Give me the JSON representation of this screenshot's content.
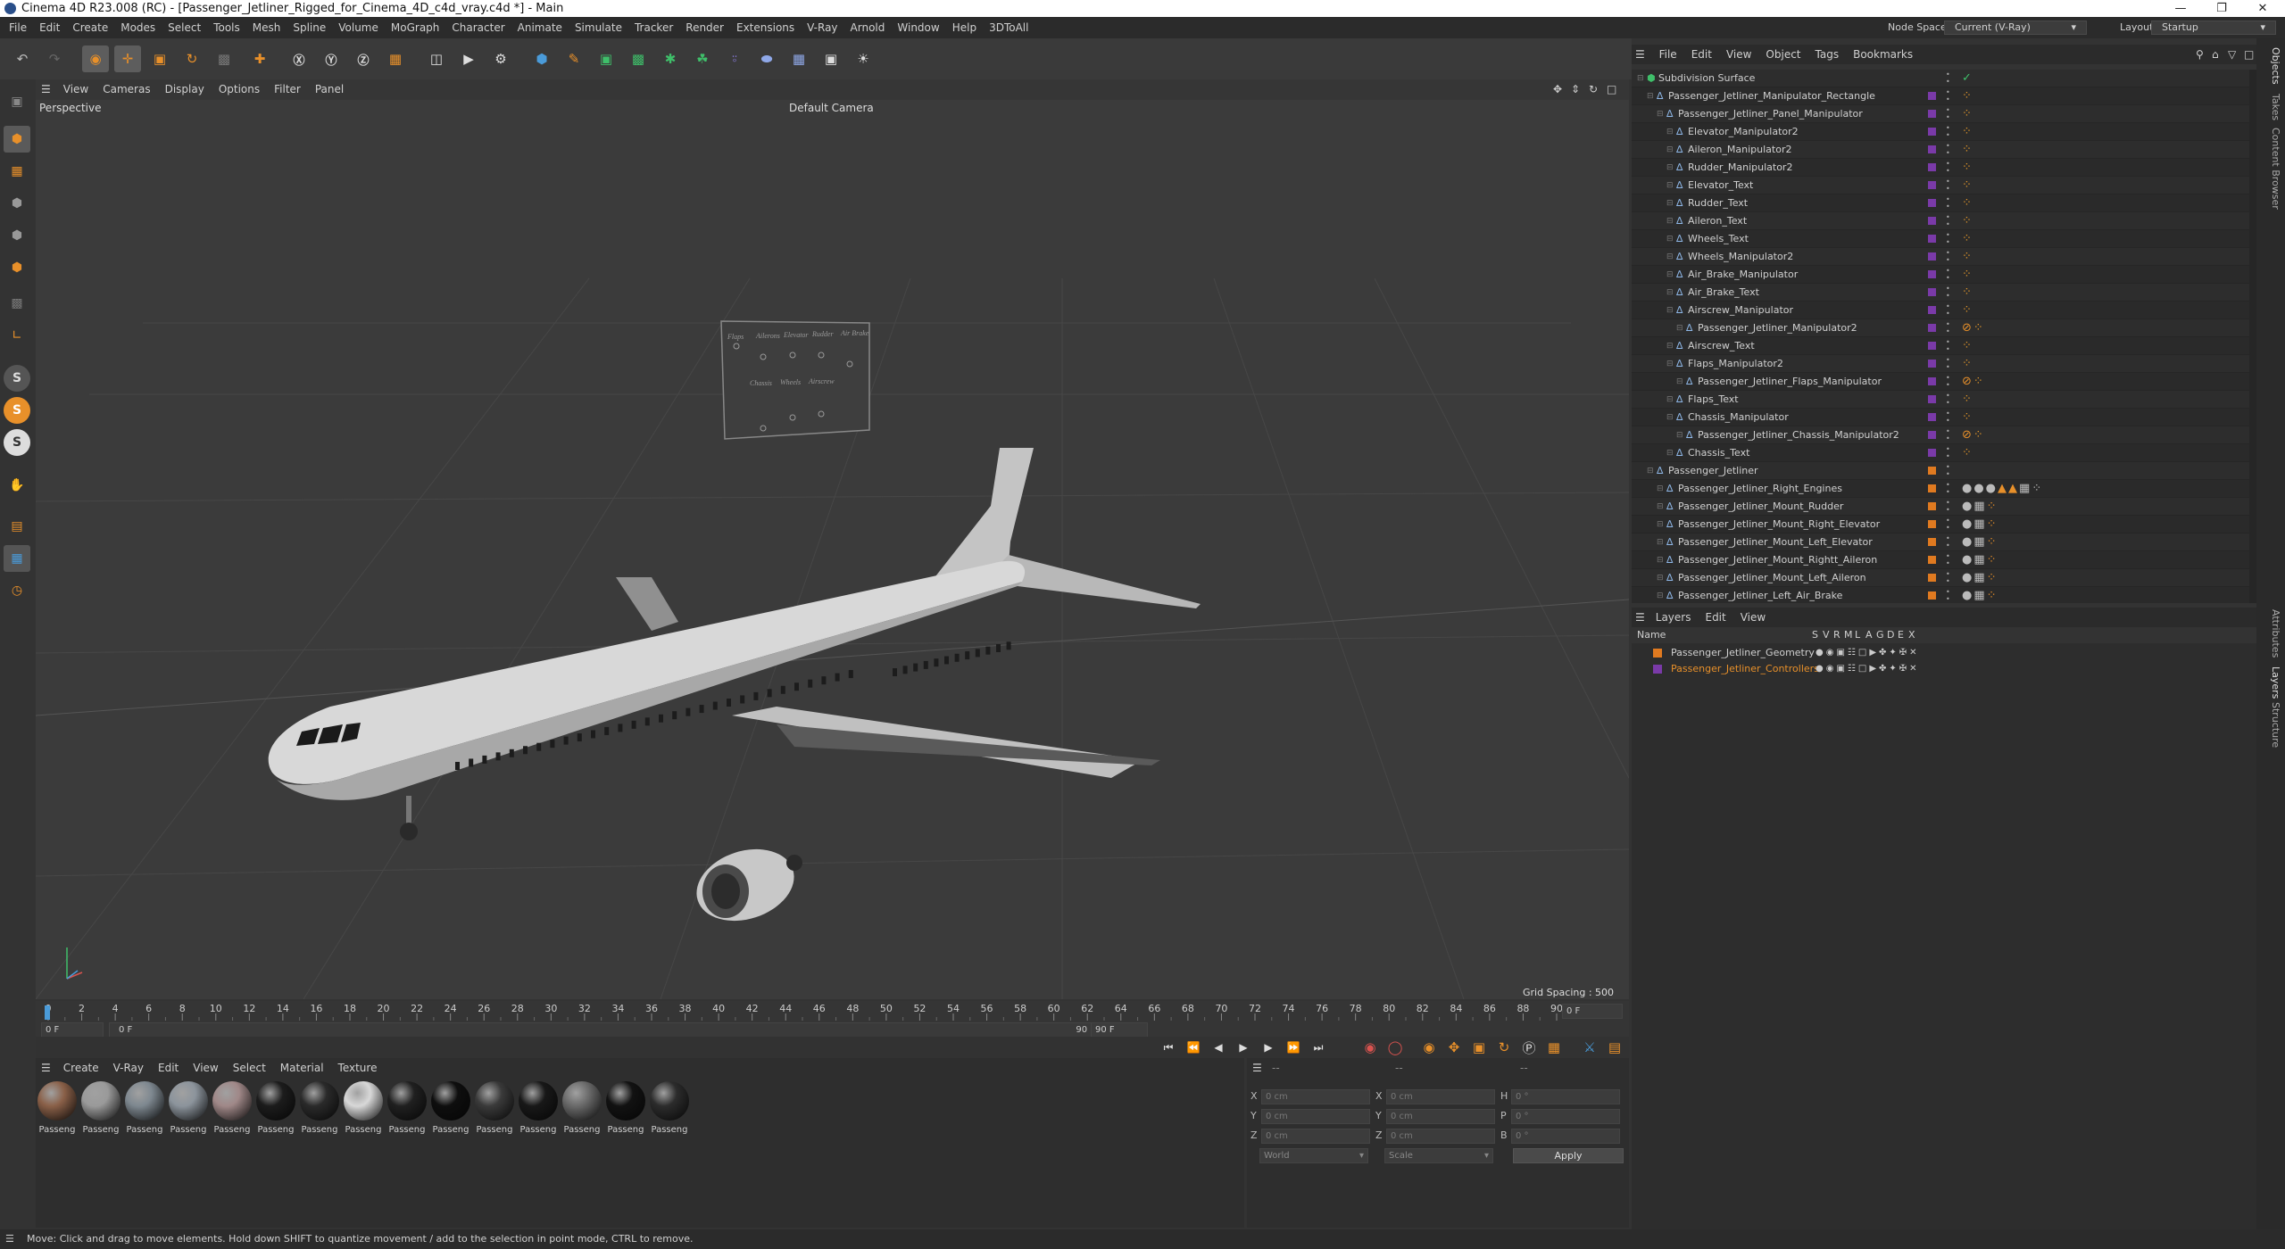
{
  "window": {
    "title": "Cinema 4D R23.008 (RC) - [Passenger_Jetliner_Rigged_for_Cinema_4D_c4d_vray.c4d *] - Main"
  },
  "menu": [
    "File",
    "Edit",
    "Create",
    "Modes",
    "Select",
    "Tools",
    "Mesh",
    "Spline",
    "Volume",
    "MoGraph",
    "Character",
    "Animate",
    "Simulate",
    "Tracker",
    "Render",
    "Extensions",
    "V-Ray",
    "Arnold",
    "Window",
    "Help",
    "3DToAll"
  ],
  "node_space": {
    "label": "Node Space:",
    "value": "Current (V-Ray)"
  },
  "layout": {
    "label": "Layout:",
    "value": "Startup"
  },
  "viewport": {
    "menu": [
      "View",
      "Cameras",
      "Display",
      "Options",
      "Filter",
      "Panel"
    ],
    "projection": "Perspective",
    "camera": "Default Camera",
    "grid_spacing": "Grid Spacing : 500 cm",
    "panel_labels_top": [
      "Flaps",
      "Ailerons",
      "Elevator",
      "Rudder",
      "Air Brake"
    ],
    "panel_labels_bottom": [
      "Chassis",
      "Wheels",
      "Airscrew"
    ]
  },
  "objects_panel": {
    "menu": [
      "File",
      "Edit",
      "View",
      "Object",
      "Tags",
      "Bookmarks"
    ],
    "rows": [
      {
        "name": "Subdivision Surface",
        "color": "",
        "tag": "check"
      },
      {
        "name": "Passenger_Jetliner_Manipulator_Rectangle",
        "color": "#7a3aa8",
        "tag": "dots"
      },
      {
        "name": "Passenger_Jetliner_Panel_Manipulator",
        "color": "#7a3aa8",
        "tag": "dots"
      },
      {
        "name": "Elevator_Manipulator2",
        "color": "#7a3aa8",
        "tag": "dots"
      },
      {
        "name": "Aileron_Manipulator2",
        "color": "#7a3aa8",
        "tag": "dots"
      },
      {
        "name": "Rudder_Manipulator2",
        "color": "#7a3aa8",
        "tag": "dots"
      },
      {
        "name": "Elevator_Text",
        "color": "#7a3aa8",
        "tag": "dots"
      },
      {
        "name": "Rudder_Text",
        "color": "#7a3aa8",
        "tag": "dots"
      },
      {
        "name": "Aileron_Text",
        "color": "#7a3aa8",
        "tag": "dots"
      },
      {
        "name": "Wheels_Text",
        "color": "#7a3aa8",
        "tag": "dots"
      },
      {
        "name": "Wheels_Manipulator2",
        "color": "#7a3aa8",
        "tag": "dots"
      },
      {
        "name": "Air_Brake_Manipulator",
        "color": "#7a3aa8",
        "tag": "dots"
      },
      {
        "name": "Air_Brake_Text",
        "color": "#7a3aa8",
        "tag": "dots"
      },
      {
        "name": "Airscrew_Manipulator",
        "color": "#7a3aa8",
        "tag": "dots"
      },
      {
        "name": "Passenger_Jetliner_Manipulator2",
        "color": "#7a3aa8",
        "tag": "xpresso"
      },
      {
        "name": "Airscrew_Text",
        "color": "#7a3aa8",
        "tag": "dots"
      },
      {
        "name": "Flaps_Manipulator2",
        "color": "#7a3aa8",
        "tag": "dots"
      },
      {
        "name": "Passenger_Jetliner_Flaps_Manipulator",
        "color": "#7a3aa8",
        "tag": "xpresso"
      },
      {
        "name": "Flaps_Text",
        "color": "#7a3aa8",
        "tag": "dots"
      },
      {
        "name": "Chassis_Manipulator",
        "color": "#7a3aa8",
        "tag": "dots"
      },
      {
        "name": "Passenger_Jetliner_Chassis_Manipulator2",
        "color": "#7a3aa8",
        "tag": "xpresso"
      },
      {
        "name": "Chassis_Text",
        "color": "#7a3aa8",
        "tag": "dots"
      },
      {
        "name": "Passenger_Jetliner",
        "color": "#e07a20",
        "tag": ""
      },
      {
        "name": "Passenger_Jetliner_Right_Engines",
        "color": "#e07a20",
        "tag": "materials"
      },
      {
        "name": "Passenger_Jetliner_Mount_Rudder",
        "color": "#e07a20",
        "tag": "mat"
      },
      {
        "name": "Passenger_Jetliner_Mount_Right_Elevator",
        "color": "#e07a20",
        "tag": "mat"
      },
      {
        "name": "Passenger_Jetliner_Mount_Left_Elevator",
        "color": "#e07a20",
        "tag": "mat"
      },
      {
        "name": "Passenger_Jetliner_Mount_Rightt_Aileron",
        "color": "#e07a20",
        "tag": "mat"
      },
      {
        "name": "Passenger_Jetliner_Mount_Left_Aileron",
        "color": "#e07a20",
        "tag": "mat"
      },
      {
        "name": "Passenger_Jetliner_Left_Air_Brake",
        "color": "#e07a20",
        "tag": "mat"
      }
    ]
  },
  "layers_panel": {
    "menu": [
      "Layers",
      "Edit",
      "View"
    ],
    "header_name": "Name",
    "columns": [
      "S",
      "V",
      "R",
      "M",
      "L",
      "A",
      "G",
      "D",
      "E",
      "X"
    ],
    "layers": [
      {
        "name": "Passenger_Jetliner_Geometry",
        "color": "#e07a20",
        "text_color": "#d0d0d0"
      },
      {
        "name": "Passenger_Jetliner_Controllers",
        "color": "#7a3aa8",
        "text_color": "#e8902a"
      }
    ]
  },
  "right_tabs": [
    "Objects",
    "Takes",
    "Content Browser",
    "Attributes",
    "Layers",
    "Structure"
  ],
  "timeline": {
    "ticks": [
      "0",
      "2",
      "4",
      "6",
      "8",
      "10",
      "12",
      "14",
      "16",
      "18",
      "20",
      "22",
      "24",
      "26",
      "28",
      "30",
      "32",
      "34",
      "36",
      "38",
      "40",
      "42",
      "44",
      "46",
      "48",
      "50",
      "52",
      "54",
      "56",
      "58",
      "60",
      "62",
      "64",
      "66",
      "68",
      "70",
      "72",
      "74",
      "76",
      "78",
      "80",
      "82",
      "84",
      "86",
      "88",
      "90"
    ],
    "current_frame": "0 F",
    "start_field": "0 F",
    "start_offset": "0 F",
    "end_frame": "90 F",
    "end_field": "90 F"
  },
  "material_panel": {
    "menu": [
      "Create",
      "V-Ray",
      "Edit",
      "View",
      "Select",
      "Material",
      "Texture"
    ],
    "materials": [
      {
        "label": "Passeng",
        "color": "#8a6048"
      },
      {
        "label": "Passeng",
        "color": "#9a9a9a"
      },
      {
        "label": "Passeng",
        "color": "#7e8890"
      },
      {
        "label": "Passeng",
        "color": "#8c949c"
      },
      {
        "label": "Passeng",
        "color": "#a08888"
      },
      {
        "label": "Passeng",
        "color": "#1c1c1c"
      },
      {
        "label": "Passeng",
        "color": "#2a2a2a"
      },
      {
        "label": "Passeng",
        "color": "#d8d8d8"
      },
      {
        "label": "Passeng",
        "color": "#202020"
      },
      {
        "label": "Passeng",
        "color": "#0e0e0e"
      },
      {
        "label": "Passeng",
        "color": "#3a3a3a"
      },
      {
        "label": "Passeng",
        "color": "#181818"
      },
      {
        "label": "Passeng",
        "color": "#6a6a6a"
      },
      {
        "label": "Passeng",
        "color": "#121212"
      },
      {
        "label": "Passeng",
        "color": "#2c2c2c"
      }
    ]
  },
  "attributes_panel": {
    "menu": [
      "--",
      "--",
      "--"
    ],
    "rows": [
      {
        "a": "X",
        "av": "0 cm",
        "b": "X",
        "bv": "0 cm",
        "c": "H",
        "cv": "0 °"
      },
      {
        "a": "Y",
        "av": "0 cm",
        "b": "Y",
        "bv": "0 cm",
        "c": "P",
        "cv": "0 °"
      },
      {
        "a": "Z",
        "av": "0 cm",
        "b": "Z",
        "bv": "0 cm",
        "c": "B",
        "cv": "0 °"
      }
    ],
    "coord_mode": "World",
    "scale_mode": "Scale",
    "apply_label": "Apply"
  },
  "status": "Move: Click and drag to move elements. Hold down SHIFT to quantize movement / add to the selection in point mode, CTRL to remove."
}
